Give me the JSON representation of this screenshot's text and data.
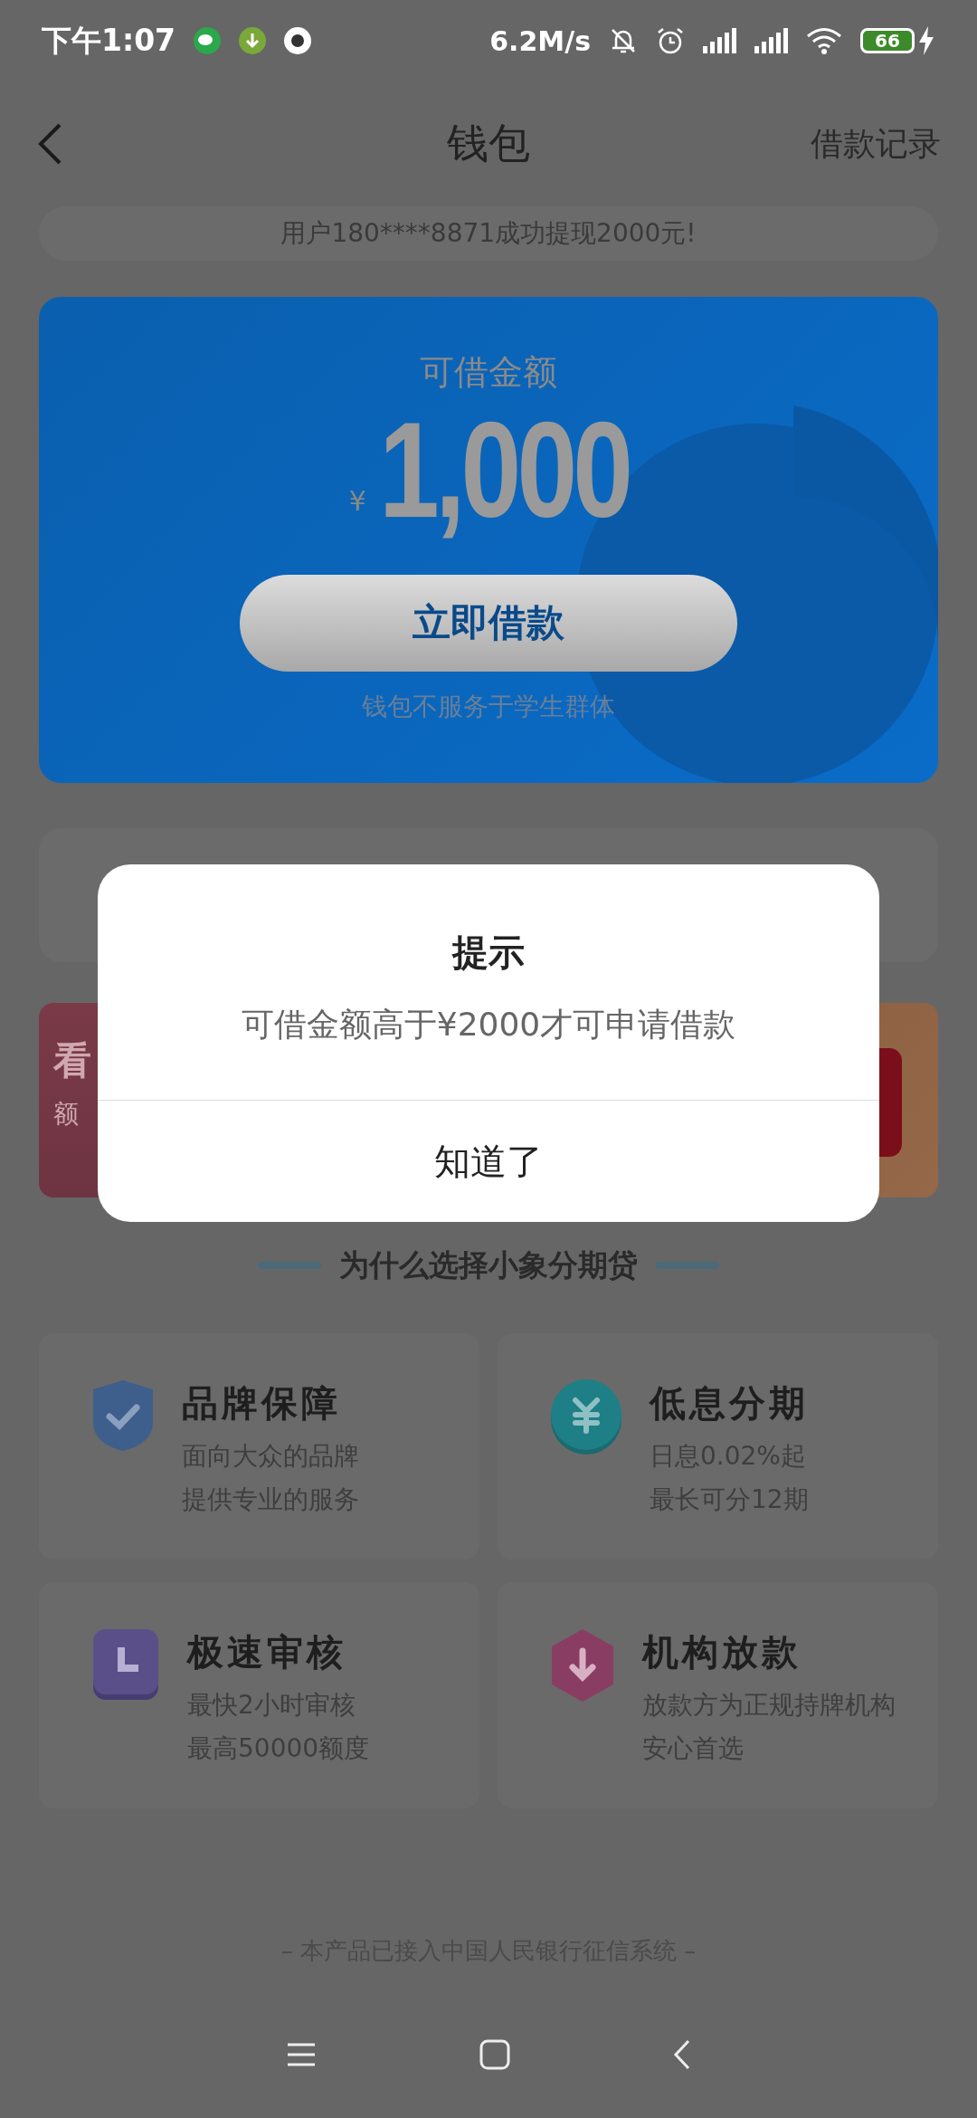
{
  "status_bar": {
    "time": "下午1:07",
    "speed": "6.2M/s",
    "battery": "66"
  },
  "header": {
    "title": "钱包",
    "action": "借款记录"
  },
  "ticker": "用户180****8871成功提现2000元!",
  "loan_card": {
    "label": "可借金额",
    "currency": "¥",
    "amount": "1,000",
    "button": "立即借款",
    "note": "钱包不服务于学生群体"
  },
  "banners": [
    {
      "kind": "pink",
      "title": "看",
      "subtitle": "额"
    },
    {
      "kind": "orange"
    }
  ],
  "section_title": "为什么选择小象分期贷",
  "features": [
    {
      "kind": "shield",
      "title": "品牌保障",
      "lines": [
        "面向大众的品牌",
        "提供专业的服务"
      ]
    },
    {
      "kind": "coin",
      "title": "低息分期",
      "lines": [
        "日息0.02%起",
        "最长可分12期"
      ]
    },
    {
      "kind": "clock",
      "title": "极速审核",
      "lines": [
        "最快2小时审核",
        "最高50000额度"
      ]
    },
    {
      "kind": "hexagon",
      "title": "机构放款",
      "lines": [
        "放款方为正规持牌机构",
        "安心首选"
      ]
    }
  ],
  "footer": "– 本产品已接入中国人民银行征信系统 –",
  "dialog": {
    "title": "提示",
    "message": "可借金额高于¥2000才可申请借款",
    "button": "知道了"
  }
}
